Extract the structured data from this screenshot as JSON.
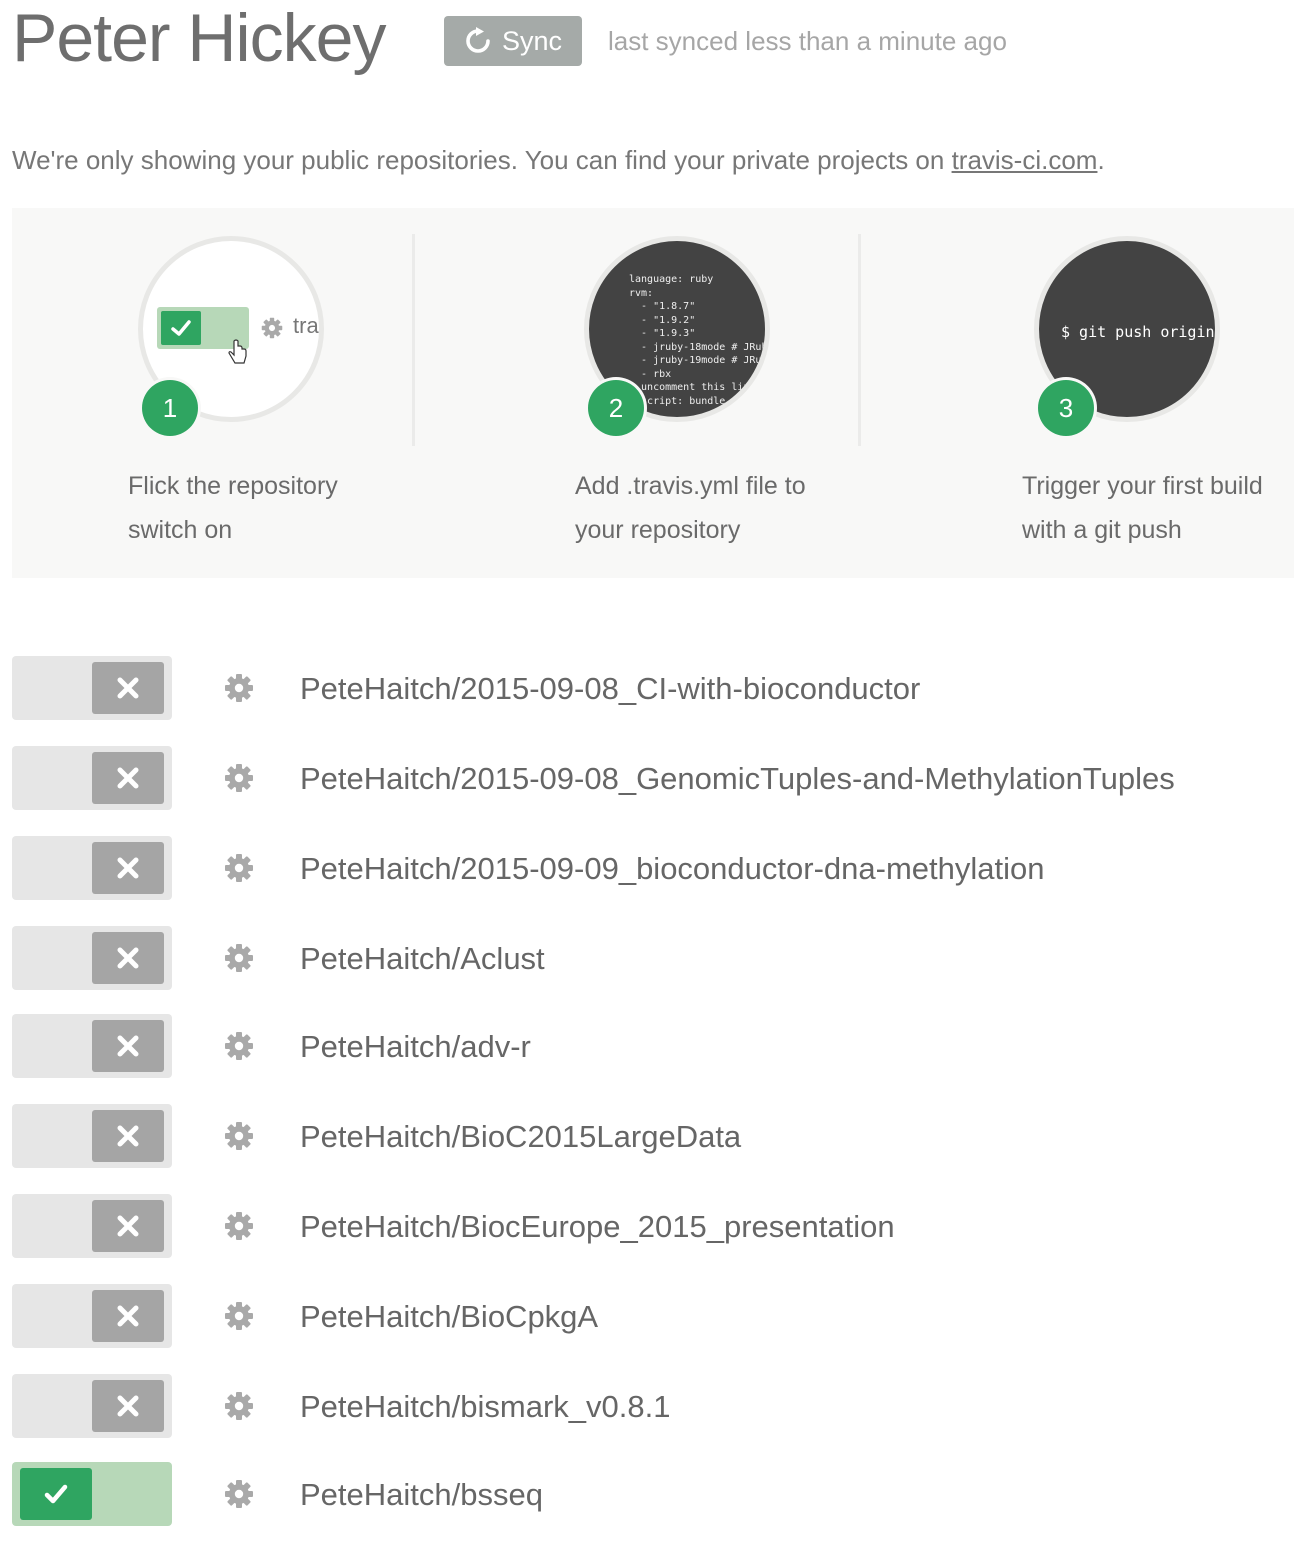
{
  "header": {
    "user_name": "Peter Hickey",
    "sync_label": "Sync",
    "sync_status": "last synced less than a minute ago"
  },
  "notice": {
    "text": "We're only showing your public repositories. You can find your private projects on ",
    "link_text": "travis-ci.com",
    "suffix": "."
  },
  "steps": [
    {
      "number": "1",
      "line1": "Flick the repository",
      "line2": "switch on",
      "illustration_label": "tra"
    },
    {
      "number": "2",
      "line1": "Add .travis.yml file to",
      "line2": "your repository",
      "code": "language: ruby\nrvm:\n  - \"1.8.7\"\n  - \"1.9.2\"\n  - \"1.9.3\"\n  - jruby-18mode # JRuby\n  - jruby-19mode # JRuby\n  - rbx\n# uncomment this line\n  script: bundle"
    },
    {
      "number": "3",
      "line1": "Trigger your first build",
      "line2": "with a git push",
      "command": "$ git push origin"
    }
  ],
  "repositories": [
    {
      "name": "PeteHaitch/2015-09-08_CI-with-bioconductor",
      "enabled": false
    },
    {
      "name": "PeteHaitch/2015-09-08_GenomicTuples-and-MethylationTuples",
      "enabled": false
    },
    {
      "name": "PeteHaitch/2015-09-09_bioconductor-dna-methylation",
      "enabled": false
    },
    {
      "name": "PeteHaitch/Aclust",
      "enabled": false
    },
    {
      "name": "PeteHaitch/adv-r",
      "enabled": false
    },
    {
      "name": "PeteHaitch/BioC2015LargeData",
      "enabled": false
    },
    {
      "name": "PeteHaitch/BiocEurope_2015_presentation",
      "enabled": false
    },
    {
      "name": "PeteHaitch/BioCpkgA",
      "enabled": false
    },
    {
      "name": "PeteHaitch/bismark_v0.8.1",
      "enabled": false
    },
    {
      "name": "PeteHaitch/bsseq",
      "enabled": true
    }
  ],
  "icons": {
    "sync": "sync-icon",
    "settings": "gear-icon",
    "off": "close-icon",
    "on": "check-icon"
  },
  "colors": {
    "accent_green": "#2fa561",
    "toggle_on_bg": "#b7d8b8",
    "toggle_off_bg": "#e6e6e6",
    "toggle_off_knob": "#a5a5a5",
    "sync_button": "#a5aaa8"
  }
}
